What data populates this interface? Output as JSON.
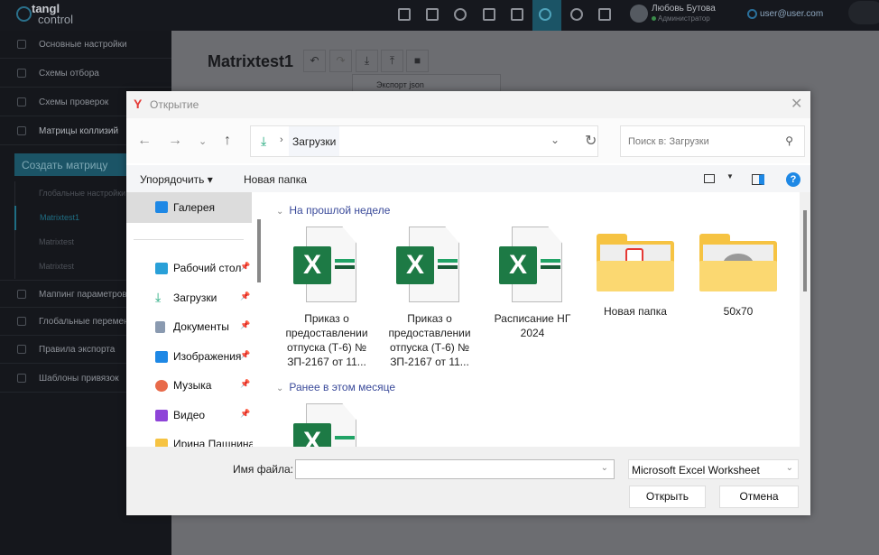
{
  "app": {
    "logo_line1": "tangl",
    "logo_line2": "control",
    "user_name": "Любовь Бутова",
    "user_role": "Администратор",
    "email": "user@user.com"
  },
  "sidebar": {
    "items": [
      "Основные настройки",
      "Схемы отбора",
      "Схемы проверок",
      "Матрицы коллизий"
    ],
    "create_button": "Создать матрицу",
    "sub_header": "Глобальные настройки",
    "sub_items": [
      "Matrixtest1",
      "Matrixtest",
      "Matrixtest"
    ],
    "items2": [
      "Маппинг параметров",
      "Глобальные переменные",
      "Правила экспорта",
      "Шаблоны привязок"
    ]
  },
  "main": {
    "title": "Matrixtest1",
    "export_item": "Экспорт json"
  },
  "dialog": {
    "title": "Открытие",
    "path": "Загрузки",
    "search_placeholder": "Поиск в: Загрузки",
    "organize": "Упорядочить ▾",
    "new_folder": "Новая папка",
    "nav": [
      {
        "label": "Галерея",
        "color": "#1e88e5"
      },
      {
        "label": "Рабочий стол",
        "color": "#29a0d8"
      },
      {
        "label": "Загрузки",
        "color": "#1aa678"
      },
      {
        "label": "Документы",
        "color": "#8a9ab0"
      },
      {
        "label": "Изображения",
        "color": "#1e88e5"
      },
      {
        "label": "Музыка",
        "color": "#e86a4a"
      },
      {
        "label": "Видео",
        "color": "#8e44d8"
      },
      {
        "label": "Ирина Пашнина",
        "color": "#f6c342"
      }
    ],
    "groups": [
      "На прошлой неделе",
      "Ранее в этом месяце"
    ],
    "files": [
      {
        "name": "Приказ о предоставлении отпуска (Т-6) № ЗП-2167 от 11...",
        "type": "excel"
      },
      {
        "name": "Приказ о предоставлении отпуска (Т-6) № ЗП-2167 от 11...",
        "type": "excel"
      },
      {
        "name": "Расписание НГ 2024",
        "type": "excel"
      },
      {
        "name": "Новая папка",
        "type": "folder-pdf"
      },
      {
        "name": "50x70",
        "type": "folder-image"
      }
    ],
    "filename_label": "Имя файла:",
    "filename_value": "",
    "filetype": "Microsoft Excel Worksheet",
    "open": "Открыть",
    "cancel": "Отмена"
  },
  "colors": {
    "accent": "#1b5466",
    "excel": "#1d7a45",
    "help": "#1e88e5"
  }
}
